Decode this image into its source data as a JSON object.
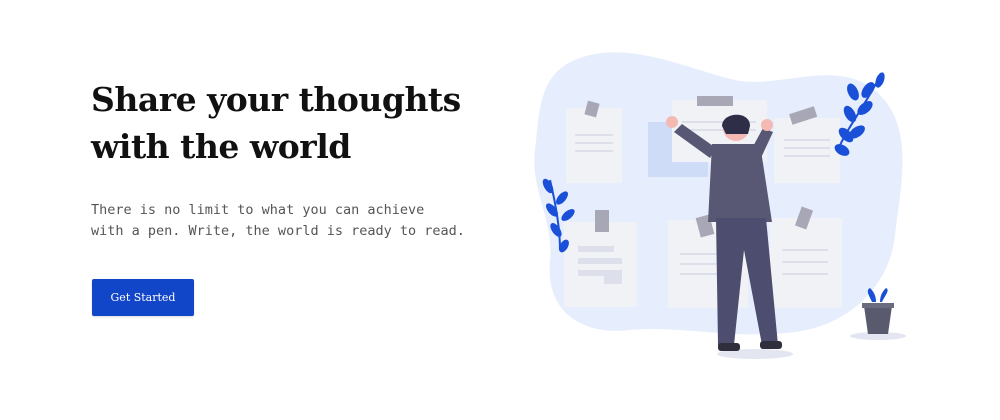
{
  "hero": {
    "title_line1": "Share your thoughts",
    "title_line2": "with the world",
    "subtitle_line1": "There is no limit to what you can achieve",
    "subtitle_line2": "with a pen. Write, the world is ready to read.",
    "cta_label": "Get Started"
  },
  "illustration": {
    "subject": "person pinning notes on a board",
    "icons": [
      "note-card-icon",
      "tape-icon",
      "plant-leaf-icon",
      "plant-pot-icon",
      "person-figure-icon"
    ]
  },
  "colors": {
    "accent": "#1146c8",
    "blob": "#e6edfd",
    "note": "#f1f2f6",
    "tape": "#a8a7b5",
    "person_suit": "#585874",
    "person_pants": "#4d4d70",
    "leaf": "#1a4fd8",
    "pot": "#5a5a6e"
  }
}
